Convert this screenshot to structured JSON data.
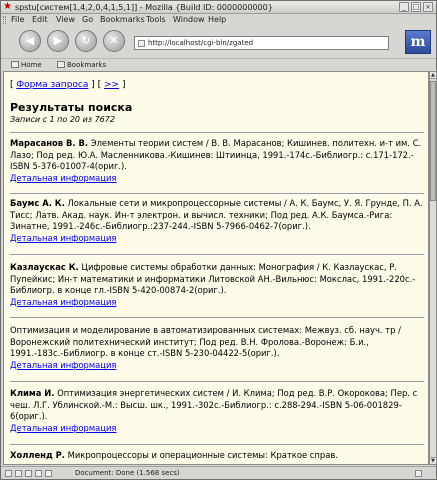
{
  "window": {
    "title": "spstu[систем[1,4,2,0,4,1,5,1]] - Mozilla {Build ID: 0000000000}",
    "minimize": "_",
    "maximize": "□",
    "close": "×"
  },
  "menu": [
    "File",
    "Edit",
    "View",
    "Go",
    "Bookmarks",
    "Tools",
    "Window",
    "Help"
  ],
  "toolbar": {
    "url": "http://localhost/cgi-bin/zgated"
  },
  "personal_bar": {
    "home": "Home",
    "bookmarks": "Bookmarks"
  },
  "page": {
    "link_form": "Форма запроса",
    "bracket_open": "[ ",
    "bracket_mid": " ] [ ",
    "link_next": ">>",
    "bracket_close": " ]",
    "heading": "Результаты поиска",
    "subheading": "Записи с 1 по 20 из 7672",
    "detail_label": "Детальная информация",
    "records": [
      {
        "author": "Марасанов В. В.",
        "text": " Элементы теории систем / В. В. Марасанов; Кишинев. политехн. и-т им. С. Лазо; Под ред. Ю.А. Масленникова.-Кишинев: Штиинца, 1991.-174с.-Библиогр.: с.171-172.-ISBN 5-376-01007-4(ориг.)."
      },
      {
        "author": "Баумс А. К.",
        "text": " Локальные сети и микропроцессорные системы / А. К. Баумс, У. Я. Грунде, П. А. Тисс; Латв. Акад. наук. Ин-т электрон. и вычисл. техники; Под ред. А.К. Баумса.-Рига: Зинатне, 1991.-246с.-Библиогр.:237-244.-ISBN 5-7966-0462-7(ориг.)."
      },
      {
        "author": "Казлаускас К.",
        "text": " Цифровые системы обработки данных: Монография / К. Казлаускас, Р. Пупейкис; Ин-т математики и информатики Литовской АН.-Вильнюс: Мокслас, 1991.-220с.-Библиогр. в конце гл.-ISBN 5-420-00874-2(ориг.)."
      },
      {
        "author": "",
        "text": "Оптимизация и моделирование в автоматизированных системах: Межвуз. сб. науч. тр / Воронежский политехнический институт; Под ред. В.Н. Фролова.-Воронеж: Б.и., 1991.-183с.-Библиогр. в конце ст.-ISBN 5-230-04422-5(ориг.)."
      },
      {
        "author": "Клима И.",
        "text": " Оптимизация энергетических систем / И. Клима; Под ред. В.Р. Окорокова; Пер. с чеш. Л.Г. Ублинской.-М.: Высш. шк., 1991.-302с.-Библиогр.: с.288-294.-ISBN 5-06-001829-6(ориг.)."
      },
      {
        "author": "Холленд Р.",
        "text": " Микропроцессоры и операционные системы: Краткое справ."
      }
    ]
  },
  "status": {
    "text": "Document: Done (1.568 secs)"
  }
}
